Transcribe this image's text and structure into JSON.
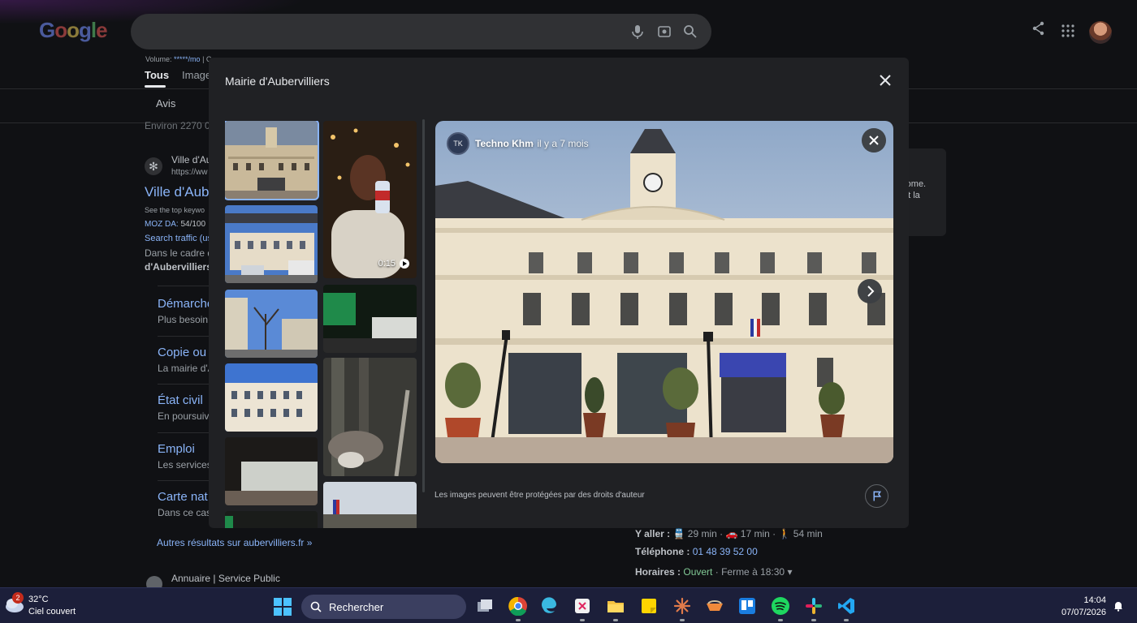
{
  "google": {
    "logo": "Google",
    "volume_label": "Volume:",
    "volume_value": "*****/mo",
    "volume_rest": "| C",
    "tabs": {
      "all": "Tous",
      "images": "Image"
    },
    "filter_chip": "Avis",
    "results_count": "Environ 2270 0"
  },
  "result": {
    "site_name": "Ville d'Au",
    "site_url": "https://ww",
    "title": "Ville d'Aube",
    "seo_line": "See the top keywo",
    "moz_label": "MOZ DA:",
    "moz_value": "54/100",
    "traffic_label": "Search traffic (us",
    "snippet_line1": "Dans le cadre d",
    "snippet_line2": "d'Aubervilliers",
    "sitelinks": [
      {
        "title": "Démarche",
        "desc": "Plus besoin"
      },
      {
        "title": "Copie ou",
        "desc": "La mairie d'A"
      },
      {
        "title": "État civil",
        "desc": "En poursuiva"
      },
      {
        "title": "Emploi",
        "desc": "Les services"
      },
      {
        "title": "Carte nat",
        "desc": "Dans ce cas"
      }
    ],
    "more_results": "Autres résultats sur aubervilliers.fr »",
    "next_result": "Annuaire | Service Public"
  },
  "knowledge_panel": {
    "card_text_line1": "rome.",
    "card_text_line2": "nt la",
    "directions_label": "Y aller :",
    "transit_time": "29 min",
    "car_time": "17 min",
    "walk_time": "54 min",
    "phone_label": "Téléphone :",
    "phone_value": "01 48 39 52 00",
    "hours_label": "Horaires :",
    "hours_status": "Ouvert",
    "hours_close": "· Ferme à 18:30 ▾"
  },
  "modal": {
    "title": "Mairie d'Aubervilliers",
    "video_duration": "0:15",
    "preview": {
      "source": "Techno Khm",
      "time_ago": "· il y a 7 mois",
      "source_icon_text": "TK"
    },
    "copyright_notice": "Les images peuvent être protégées par des droits d'auteur"
  },
  "taskbar": {
    "weather_badge": "2",
    "temperature": "32°C",
    "condition": "Ciel couvert",
    "search_label": "Rechercher",
    "time": "14:04",
    "date": "07/07/2026"
  }
}
